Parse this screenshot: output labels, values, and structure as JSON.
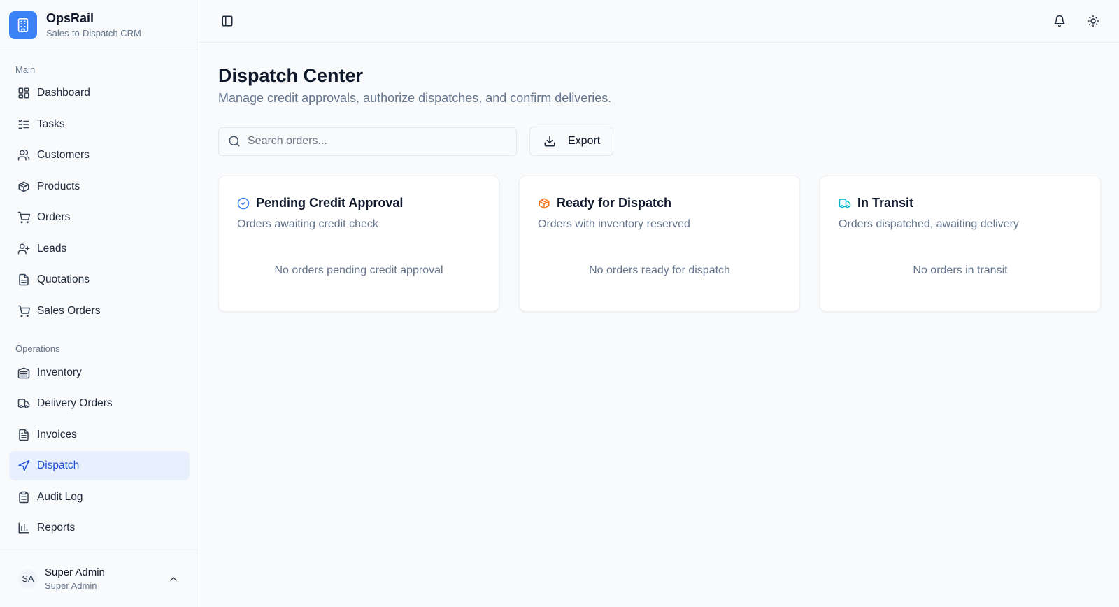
{
  "brand": {
    "name": "OpsRail",
    "subtitle": "Sales-to-Dispatch CRM",
    "logo_icon": "building-icon"
  },
  "sidebar": {
    "sections": [
      {
        "label": "Main",
        "items": [
          {
            "label": "Dashboard",
            "icon": "dashboard-icon"
          },
          {
            "label": "Tasks",
            "icon": "tasks-icon"
          },
          {
            "label": "Customers",
            "icon": "users-icon"
          },
          {
            "label": "Products",
            "icon": "package-icon"
          },
          {
            "label": "Orders",
            "icon": "cart-icon"
          },
          {
            "label": "Leads",
            "icon": "user-plus-icon"
          },
          {
            "label": "Quotations",
            "icon": "file-icon"
          },
          {
            "label": "Sales Orders",
            "icon": "cart-icon"
          }
        ]
      },
      {
        "label": "Operations",
        "items": [
          {
            "label": "Inventory",
            "icon": "warehouse-icon"
          },
          {
            "label": "Delivery Orders",
            "icon": "truck-icon"
          },
          {
            "label": "Invoices",
            "icon": "file-text-icon"
          },
          {
            "label": "Dispatch",
            "icon": "send-icon",
            "active": true
          },
          {
            "label": "Audit Log",
            "icon": "clipboard-icon"
          },
          {
            "label": "Reports",
            "icon": "bar-chart-icon"
          }
        ]
      }
    ]
  },
  "user": {
    "initials": "SA",
    "name": "Super Admin",
    "role": "Super Admin"
  },
  "topbar": {
    "sidebar_toggle_icon": "panel-left-icon",
    "notification_icon": "bell-icon",
    "theme_icon": "sun-icon"
  },
  "page": {
    "title": "Dispatch Center",
    "subtitle": "Manage credit approvals, authorize dispatches, and confirm deliveries."
  },
  "search": {
    "placeholder": "Search orders...",
    "value": ""
  },
  "export": {
    "label": "Export",
    "icon": "download-icon"
  },
  "cards": [
    {
      "title": "Pending Credit Approval",
      "description": "Orders awaiting credit check",
      "empty": "No orders pending credit approval",
      "icon": "circle-check-icon",
      "color": "#3b82f6"
    },
    {
      "title": "Ready for Dispatch",
      "description": "Orders with inventory reserved",
      "empty": "No orders ready for dispatch",
      "icon": "package-icon",
      "color": "#f97316"
    },
    {
      "title": "In Transit",
      "description": "Orders dispatched, awaiting delivery",
      "empty": "No orders in transit",
      "icon": "truck-icon",
      "color": "#06b6d4"
    }
  ],
  "colors": {
    "accent": "#3b82f6",
    "active_bg": "#e8f0fd",
    "active_text": "#1d4ed8"
  }
}
